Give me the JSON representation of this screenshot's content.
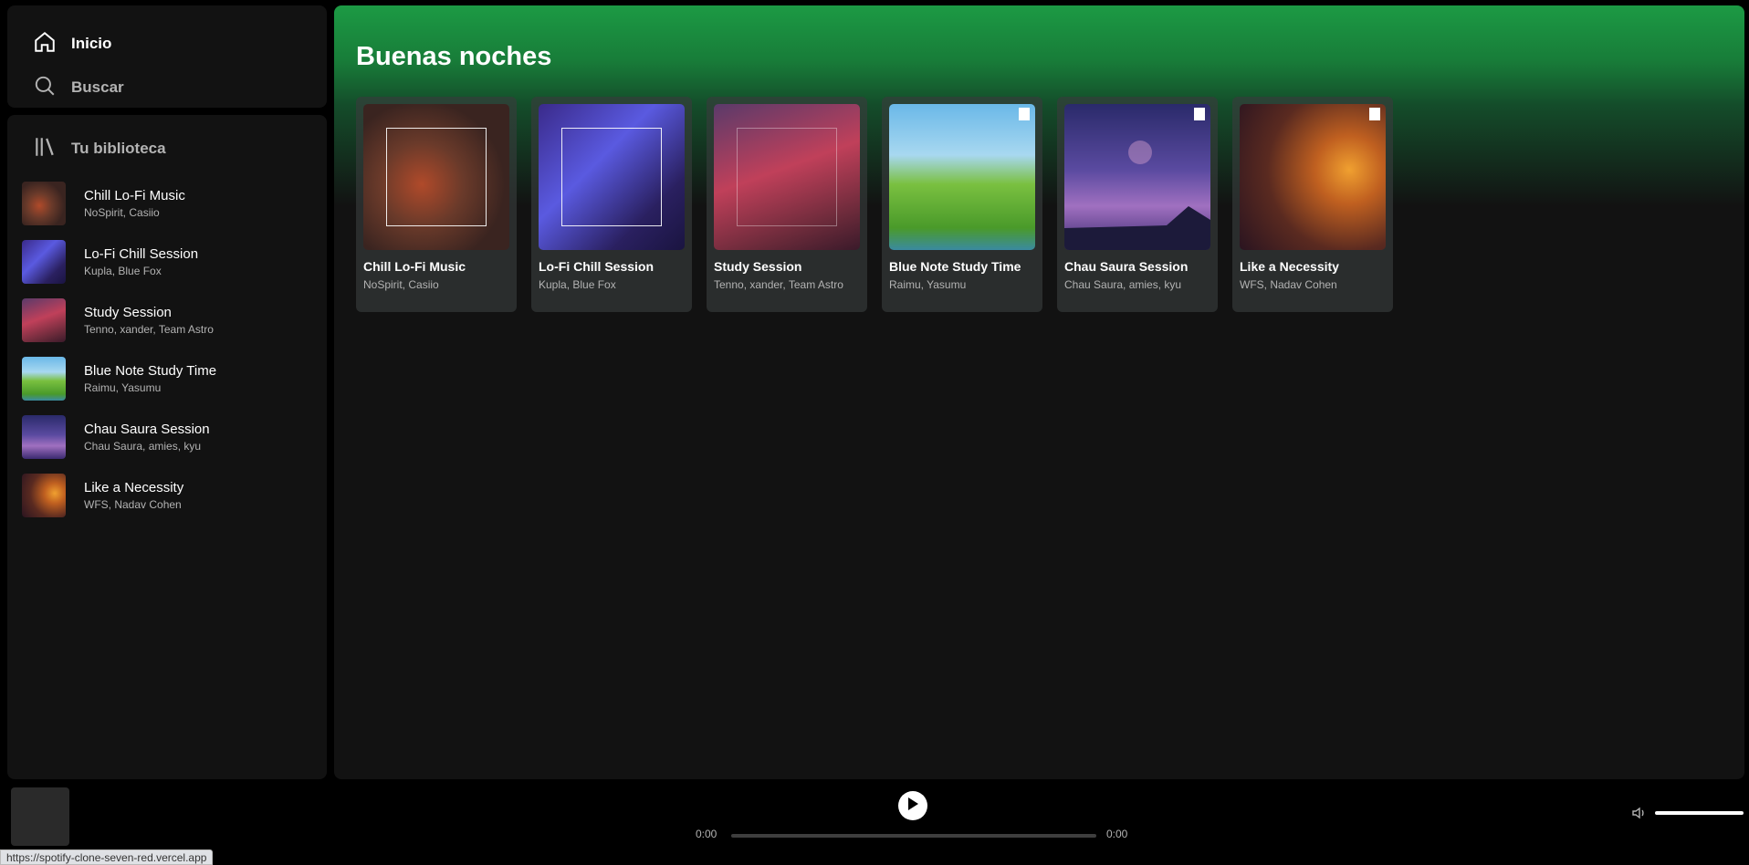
{
  "nav": {
    "home_label": "Inicio",
    "search_label": "Buscar"
  },
  "library": {
    "title": "Tu biblioteca",
    "items": [
      {
        "title": "Chill Lo-Fi Music",
        "subtitle": "NoSpirit, Casiio"
      },
      {
        "title": "Lo-Fi Chill Session",
        "subtitle": "Kupla, Blue Fox"
      },
      {
        "title": "Study Session",
        "subtitle": "Tenno, xander, Team Astro"
      },
      {
        "title": "Blue Note Study Time",
        "subtitle": "Raimu, Yasumu"
      },
      {
        "title": "Chau Saura Session",
        "subtitle": "Chau Saura, amies, kyu"
      },
      {
        "title": "Like a Necessity",
        "subtitle": "WFS, Nadav Cohen"
      }
    ]
  },
  "main": {
    "greeting": "Buenas noches",
    "cards": [
      {
        "title": "Chill Lo-Fi Music",
        "subtitle": "NoSpirit, Casiio"
      },
      {
        "title": "Lo-Fi Chill Session",
        "subtitle": "Kupla, Blue Fox"
      },
      {
        "title": "Study Session",
        "subtitle": "Tenno, xander, Team Astro"
      },
      {
        "title": "Blue Note Study Time",
        "subtitle": "Raimu, Yasumu"
      },
      {
        "title": "Chau Saura Session",
        "subtitle": "Chau Saura, amies, kyu"
      },
      {
        "title": "Like a Necessity",
        "subtitle": "WFS, Nadav Cohen"
      }
    ]
  },
  "player": {
    "current_time": "0:00",
    "duration": "0:00",
    "volume": 1.0
  },
  "status_bar": {
    "url": "https://spotify-clone-seven-red.vercel.app"
  },
  "colors": {
    "accent": "#1db954",
    "background": "#121212",
    "header_gradient": "#1c9a44"
  },
  "icons": {
    "home": "home-icon",
    "search": "search-icon",
    "library": "library-icon",
    "play": "play-icon",
    "volume": "volume-icon"
  }
}
